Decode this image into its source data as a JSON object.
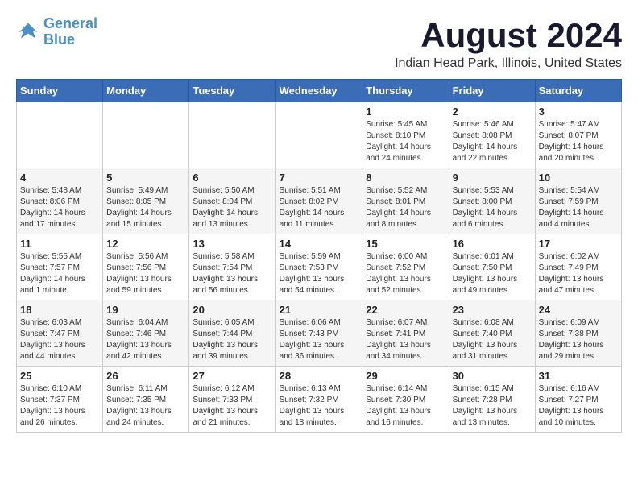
{
  "logo": {
    "line1": "General",
    "line2": "Blue"
  },
  "title": "August 2024",
  "subtitle": "Indian Head Park, Illinois, United States",
  "days_of_week": [
    "Sunday",
    "Monday",
    "Tuesday",
    "Wednesday",
    "Thursday",
    "Friday",
    "Saturday"
  ],
  "weeks": [
    [
      {
        "day": "",
        "info": ""
      },
      {
        "day": "",
        "info": ""
      },
      {
        "day": "",
        "info": ""
      },
      {
        "day": "",
        "info": ""
      },
      {
        "day": "1",
        "info": "Sunrise: 5:45 AM\nSunset: 8:10 PM\nDaylight: 14 hours\nand 24 minutes."
      },
      {
        "day": "2",
        "info": "Sunrise: 5:46 AM\nSunset: 8:08 PM\nDaylight: 14 hours\nand 22 minutes."
      },
      {
        "day": "3",
        "info": "Sunrise: 5:47 AM\nSunset: 8:07 PM\nDaylight: 14 hours\nand 20 minutes."
      }
    ],
    [
      {
        "day": "4",
        "info": "Sunrise: 5:48 AM\nSunset: 8:06 PM\nDaylight: 14 hours\nand 17 minutes."
      },
      {
        "day": "5",
        "info": "Sunrise: 5:49 AM\nSunset: 8:05 PM\nDaylight: 14 hours\nand 15 minutes."
      },
      {
        "day": "6",
        "info": "Sunrise: 5:50 AM\nSunset: 8:04 PM\nDaylight: 14 hours\nand 13 minutes."
      },
      {
        "day": "7",
        "info": "Sunrise: 5:51 AM\nSunset: 8:02 PM\nDaylight: 14 hours\nand 11 minutes."
      },
      {
        "day": "8",
        "info": "Sunrise: 5:52 AM\nSunset: 8:01 PM\nDaylight: 14 hours\nand 8 minutes."
      },
      {
        "day": "9",
        "info": "Sunrise: 5:53 AM\nSunset: 8:00 PM\nDaylight: 14 hours\nand 6 minutes."
      },
      {
        "day": "10",
        "info": "Sunrise: 5:54 AM\nSunset: 7:59 PM\nDaylight: 14 hours\nand 4 minutes."
      }
    ],
    [
      {
        "day": "11",
        "info": "Sunrise: 5:55 AM\nSunset: 7:57 PM\nDaylight: 14 hours\nand 1 minute."
      },
      {
        "day": "12",
        "info": "Sunrise: 5:56 AM\nSunset: 7:56 PM\nDaylight: 13 hours\nand 59 minutes."
      },
      {
        "day": "13",
        "info": "Sunrise: 5:58 AM\nSunset: 7:54 PM\nDaylight: 13 hours\nand 56 minutes."
      },
      {
        "day": "14",
        "info": "Sunrise: 5:59 AM\nSunset: 7:53 PM\nDaylight: 13 hours\nand 54 minutes."
      },
      {
        "day": "15",
        "info": "Sunrise: 6:00 AM\nSunset: 7:52 PM\nDaylight: 13 hours\nand 52 minutes."
      },
      {
        "day": "16",
        "info": "Sunrise: 6:01 AM\nSunset: 7:50 PM\nDaylight: 13 hours\nand 49 minutes."
      },
      {
        "day": "17",
        "info": "Sunrise: 6:02 AM\nSunset: 7:49 PM\nDaylight: 13 hours\nand 47 minutes."
      }
    ],
    [
      {
        "day": "18",
        "info": "Sunrise: 6:03 AM\nSunset: 7:47 PM\nDaylight: 13 hours\nand 44 minutes."
      },
      {
        "day": "19",
        "info": "Sunrise: 6:04 AM\nSunset: 7:46 PM\nDaylight: 13 hours\nand 42 minutes."
      },
      {
        "day": "20",
        "info": "Sunrise: 6:05 AM\nSunset: 7:44 PM\nDaylight: 13 hours\nand 39 minutes."
      },
      {
        "day": "21",
        "info": "Sunrise: 6:06 AM\nSunset: 7:43 PM\nDaylight: 13 hours\nand 36 minutes."
      },
      {
        "day": "22",
        "info": "Sunrise: 6:07 AM\nSunset: 7:41 PM\nDaylight: 13 hours\nand 34 minutes."
      },
      {
        "day": "23",
        "info": "Sunrise: 6:08 AM\nSunset: 7:40 PM\nDaylight: 13 hours\nand 31 minutes."
      },
      {
        "day": "24",
        "info": "Sunrise: 6:09 AM\nSunset: 7:38 PM\nDaylight: 13 hours\nand 29 minutes."
      }
    ],
    [
      {
        "day": "25",
        "info": "Sunrise: 6:10 AM\nSunset: 7:37 PM\nDaylight: 13 hours\nand 26 minutes."
      },
      {
        "day": "26",
        "info": "Sunrise: 6:11 AM\nSunset: 7:35 PM\nDaylight: 13 hours\nand 24 minutes."
      },
      {
        "day": "27",
        "info": "Sunrise: 6:12 AM\nSunset: 7:33 PM\nDaylight: 13 hours\nand 21 minutes."
      },
      {
        "day": "28",
        "info": "Sunrise: 6:13 AM\nSunset: 7:32 PM\nDaylight: 13 hours\nand 18 minutes."
      },
      {
        "day": "29",
        "info": "Sunrise: 6:14 AM\nSunset: 7:30 PM\nDaylight: 13 hours\nand 16 minutes."
      },
      {
        "day": "30",
        "info": "Sunrise: 6:15 AM\nSunset: 7:28 PM\nDaylight: 13 hours\nand 13 minutes."
      },
      {
        "day": "31",
        "info": "Sunrise: 6:16 AM\nSunset: 7:27 PM\nDaylight: 13 hours\nand 10 minutes."
      }
    ]
  ]
}
